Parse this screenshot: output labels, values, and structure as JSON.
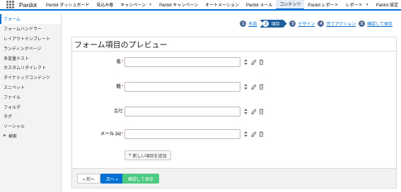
{
  "top_nav": {
    "app_name": "Pardot",
    "items": [
      {
        "label": "Pardot ダッシュボード",
        "has_menu": false,
        "active": false
      },
      {
        "label": "見込み客",
        "has_menu": false,
        "active": false
      },
      {
        "label": "キャンペーン",
        "has_menu": true,
        "active": false
      },
      {
        "label": "Pardot キャンペーン",
        "has_menu": false,
        "active": false
      },
      {
        "label": "オートメーション",
        "has_menu": false,
        "active": false
      },
      {
        "label": "Pardot メール",
        "has_menu": false,
        "active": false
      },
      {
        "label": "コンテンツ",
        "has_menu": false,
        "active": true
      },
      {
        "label": "Pardot レポート",
        "has_menu": false,
        "active": false
      },
      {
        "label": "レポート",
        "has_menu": true,
        "active": false
      },
      {
        "label": "Pardot 設定",
        "has_menu": false,
        "active": false
      }
    ]
  },
  "sidebar": {
    "items": [
      {
        "label": "フォーム",
        "selected": true
      },
      {
        "label": "フォームハンドラー",
        "selected": false
      },
      {
        "label": "レイアウトテンプレート",
        "selected": false
      },
      {
        "label": "ランディングページ",
        "selected": false
      },
      {
        "label": "多変量テスト",
        "selected": false
      },
      {
        "label": "カスタムリダイレクト",
        "selected": false
      },
      {
        "label": "ダイナミックコンテンツ",
        "selected": false
      },
      {
        "label": "スニペット",
        "selected": false
      },
      {
        "label": "ファイル",
        "selected": false
      },
      {
        "label": "フォルダ",
        "selected": false
      },
      {
        "label": "タグ",
        "selected": false
      },
      {
        "label": "ソーシャル",
        "selected": false
      },
      {
        "label": "検索",
        "selected": false,
        "expandable": true
      }
    ]
  },
  "wizard": {
    "steps": [
      {
        "num": "1",
        "label": "名前",
        "current": false
      },
      {
        "num": "2",
        "label": "項目",
        "current": true
      },
      {
        "num": "3",
        "label": "デザイン",
        "current": false
      },
      {
        "num": "4",
        "label": "完了アクション",
        "current": false
      },
      {
        "num": "5",
        "label": "確認して保存",
        "current": false
      }
    ]
  },
  "panel": {
    "title": "フォーム項目のプレビュー",
    "fields": [
      {
        "label": "名",
        "required": true,
        "value": ""
      },
      {
        "label": "姓",
        "required": true,
        "value": ""
      },
      {
        "label": "会社",
        "required": false,
        "value": ""
      },
      {
        "label": "メール (a)",
        "required": true,
        "value": ""
      }
    ],
    "required_marker": "*",
    "add_button": {
      "icon": "+",
      "label": "新しい項目を追加"
    }
  },
  "footer": {
    "prev_label": "« 前へ",
    "next_label": "次へ »",
    "save_label": "確認して保存"
  },
  "colors": {
    "brand_blue": "#0070d2",
    "current_step": "#1b5f9e",
    "save_green": "#4bca81"
  },
  "icons": {
    "app_launcher": "waffle-icon",
    "field_sort": "sort-arrows-icon",
    "field_edit": "edit-icon",
    "field_delete": "trash-icon"
  }
}
